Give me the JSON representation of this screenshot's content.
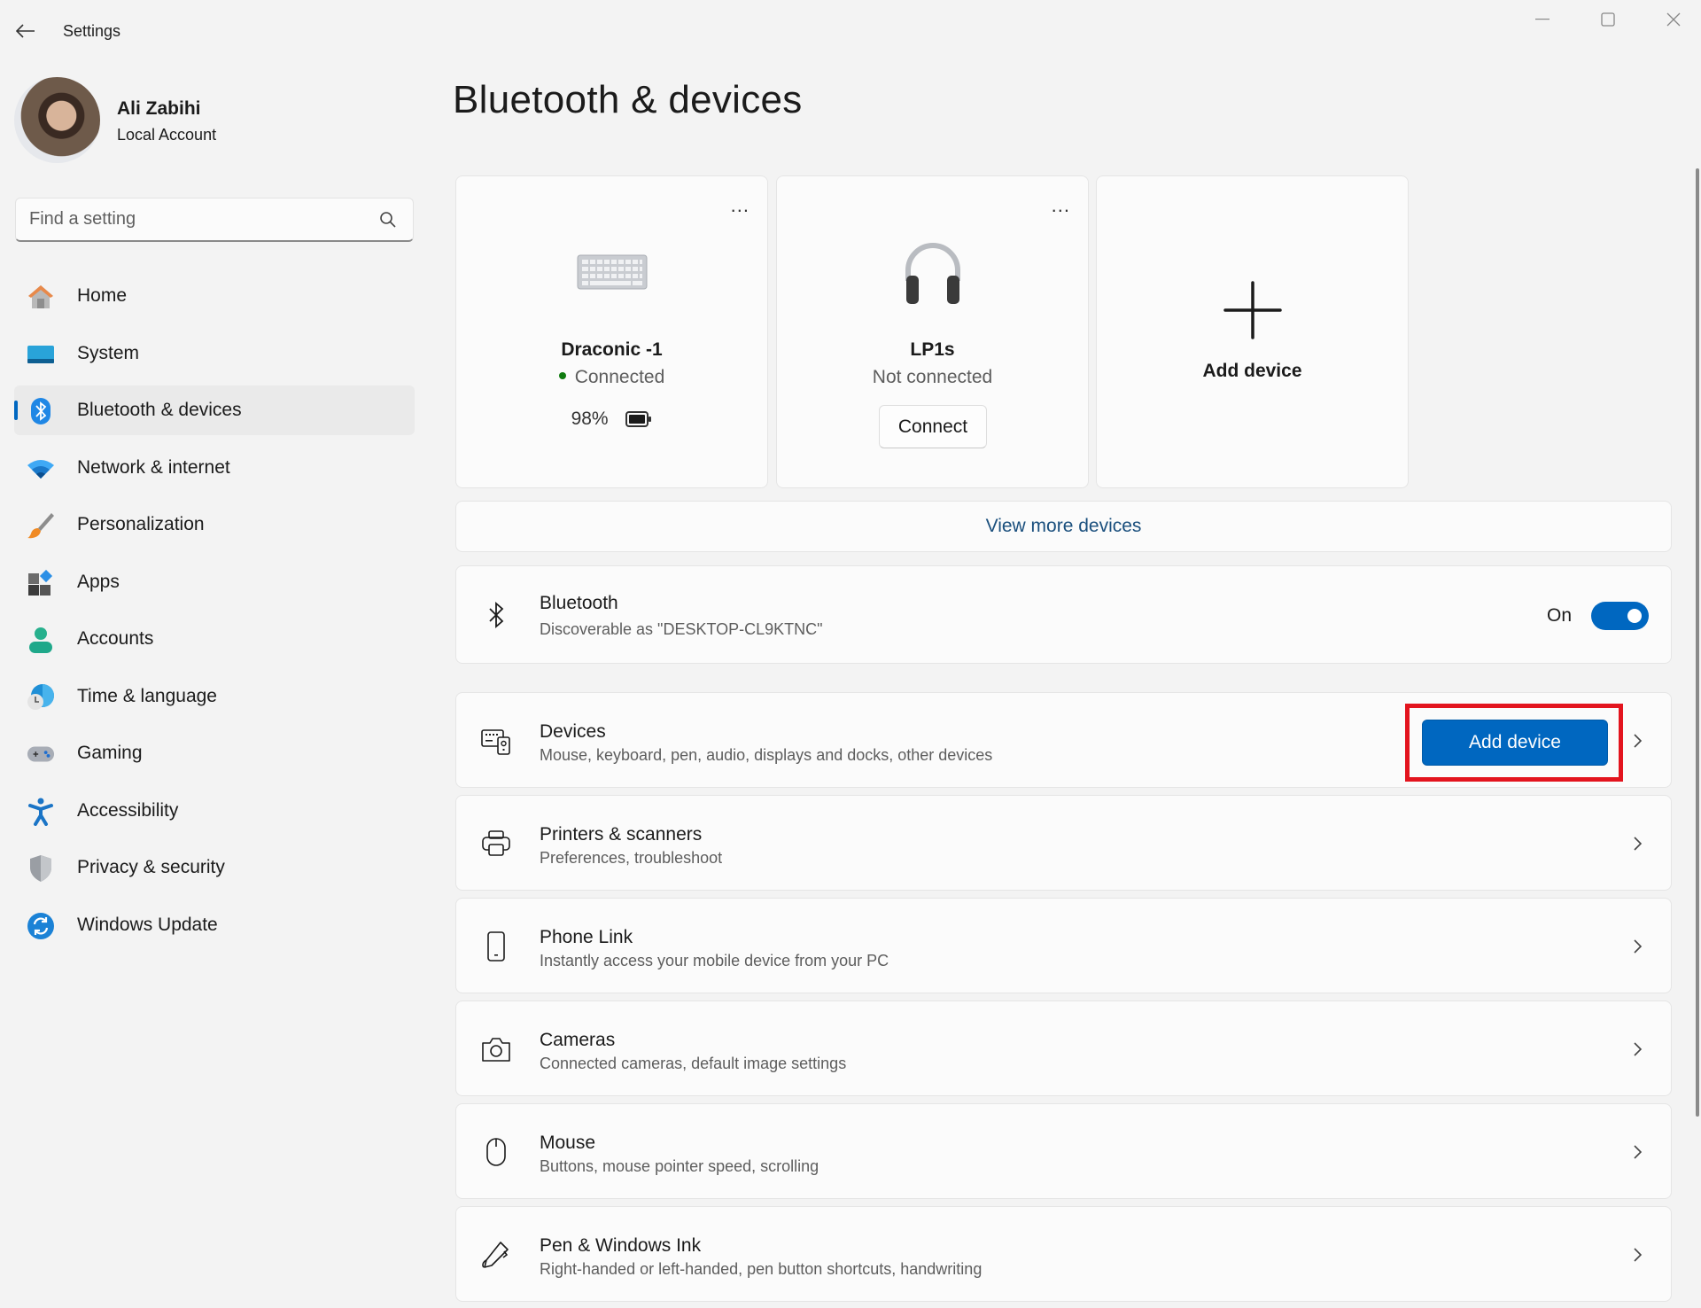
{
  "window": {
    "title": "Settings",
    "controls": {
      "minimize": "minimize-icon",
      "maximize": "maximize-icon",
      "close": "close-icon"
    }
  },
  "profile": {
    "name": "Ali Zabihi",
    "account_type": "Local Account"
  },
  "search": {
    "placeholder": "Find a setting",
    "value": ""
  },
  "sidebar": {
    "items": [
      {
        "label": "Home",
        "icon": "home-icon",
        "active": false
      },
      {
        "label": "System",
        "icon": "system-icon",
        "active": false
      },
      {
        "label": "Bluetooth & devices",
        "icon": "bluetooth-icon",
        "active": true
      },
      {
        "label": "Network & internet",
        "icon": "wifi-icon",
        "active": false
      },
      {
        "label": "Personalization",
        "icon": "brush-icon",
        "active": false
      },
      {
        "label": "Apps",
        "icon": "apps-icon",
        "active": false
      },
      {
        "label": "Accounts",
        "icon": "person-icon",
        "active": false
      },
      {
        "label": "Time & language",
        "icon": "globe-clock-icon",
        "active": false
      },
      {
        "label": "Gaming",
        "icon": "gamepad-icon",
        "active": false
      },
      {
        "label": "Accessibility",
        "icon": "accessibility-icon",
        "active": false
      },
      {
        "label": "Privacy & security",
        "icon": "shield-icon",
        "active": false
      },
      {
        "label": "Windows Update",
        "icon": "update-icon",
        "active": false
      }
    ]
  },
  "main": {
    "title": "Bluetooth & devices",
    "device_cards": [
      {
        "name": "Draconic -1",
        "status": "Connected",
        "battery": "98%",
        "icon": "keyboard-icon",
        "more": "..."
      },
      {
        "name": "LP1s",
        "status": "Not connected",
        "action": "Connect",
        "icon": "headphones-icon",
        "more": "..."
      },
      {
        "name": "Add device",
        "icon": "plus-icon"
      }
    ],
    "view_more": "View more devices",
    "bluetooth": {
      "title": "Bluetooth",
      "subtitle": "Discoverable as \"DESKTOP-CL9KTNC\"",
      "toggle_label": "On",
      "toggle_on": true
    },
    "rows": [
      {
        "title": "Devices",
        "subtitle": "Mouse, keyboard, pen, audio, displays and docks, other devices",
        "icon": "devices-icon",
        "button": "Add device"
      },
      {
        "title": "Printers & scanners",
        "subtitle": "Preferences, troubleshoot",
        "icon": "printer-icon"
      },
      {
        "title": "Phone Link",
        "subtitle": "Instantly access your mobile device from your PC",
        "icon": "phone-icon"
      },
      {
        "title": "Cameras",
        "subtitle": "Connected cameras, default image settings",
        "icon": "camera-icon"
      },
      {
        "title": "Mouse",
        "subtitle": "Buttons, mouse pointer speed, scrolling",
        "icon": "mouse-icon"
      },
      {
        "title": "Pen & Windows Ink",
        "subtitle": "Right-handed or left-handed, pen button shortcuts, handwriting",
        "icon": "pen-icon"
      }
    ]
  },
  "colors": {
    "accent": "#0067c0",
    "highlight": "#e3141e",
    "connected_dot": "#0f7b0f",
    "link": "#1a4f7d"
  }
}
